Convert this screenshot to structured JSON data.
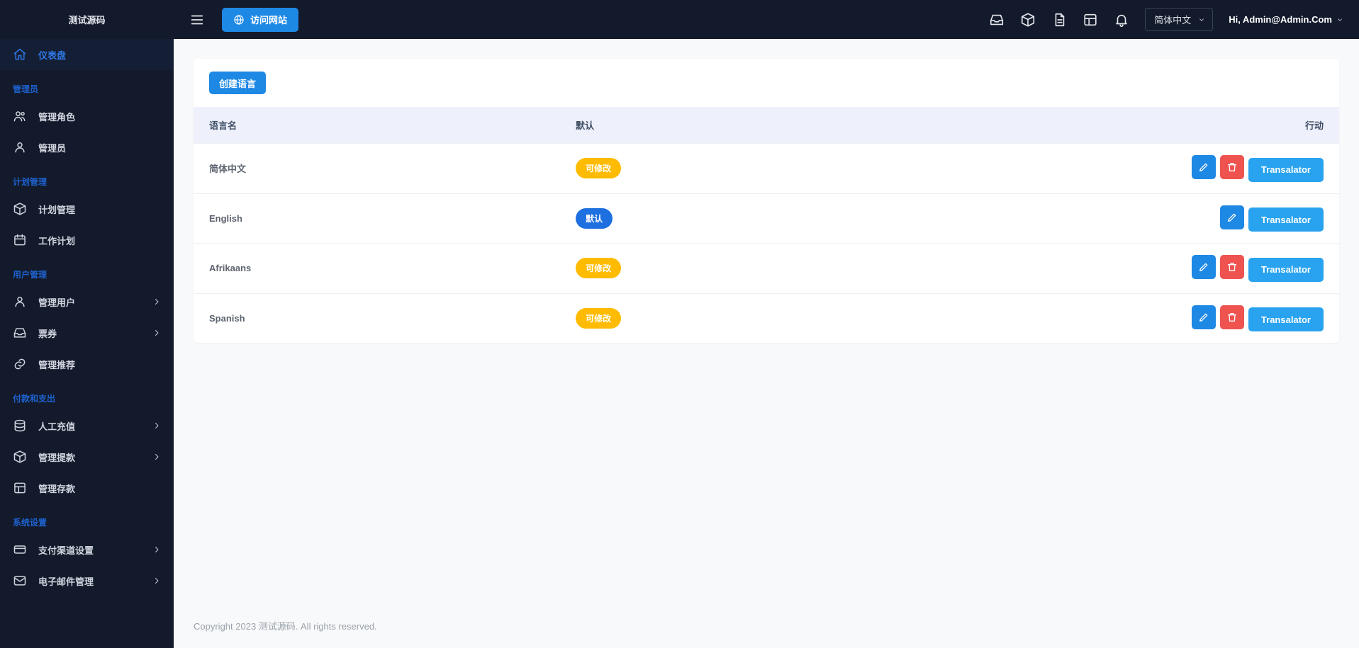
{
  "brand": "测试源码",
  "topbar": {
    "visit_label": "访问网站",
    "language": "简体中文",
    "greeting": "Hi, Admin@Admin.Com"
  },
  "sidebar": {
    "items": [
      {
        "label": "仪表盘"
      }
    ],
    "groups": [
      {
        "title": "管理员",
        "items": [
          {
            "label": "管理角色"
          },
          {
            "label": "管理员"
          }
        ]
      },
      {
        "title": "计划管理",
        "items": [
          {
            "label": "计划管理"
          },
          {
            "label": "工作计划"
          }
        ]
      },
      {
        "title": "用户管理",
        "items": [
          {
            "label": "管理用户",
            "has_children": true
          },
          {
            "label": "票券",
            "has_children": true
          },
          {
            "label": "管理推荐"
          }
        ]
      },
      {
        "title": "付款和支出",
        "items": [
          {
            "label": "人工充值",
            "has_children": true
          },
          {
            "label": "管理提款",
            "has_children": true
          },
          {
            "label": "管理存款"
          }
        ]
      },
      {
        "title": "系统设置",
        "items": [
          {
            "label": "支付渠道设置",
            "has_children": true
          },
          {
            "label": "电子邮件管理",
            "has_children": true
          }
        ]
      }
    ]
  },
  "page": {
    "create_btn": "创建语言",
    "columns": {
      "name": "语言名",
      "default": "默认",
      "action": "行动"
    },
    "badge_modifiable": "可修改",
    "badge_default": "默认",
    "translator_btn": "Transalator",
    "rows": [
      {
        "name": "简体中文",
        "badge": "modifiable",
        "deletable": true
      },
      {
        "name": "English",
        "badge": "default",
        "deletable": false
      },
      {
        "name": "Afrikaans",
        "badge": "modifiable",
        "deletable": true
      },
      {
        "name": "Spanish",
        "badge": "modifiable",
        "deletable": true
      }
    ]
  },
  "footer": "Copyright 2023 测试源码. All rights reserved."
}
